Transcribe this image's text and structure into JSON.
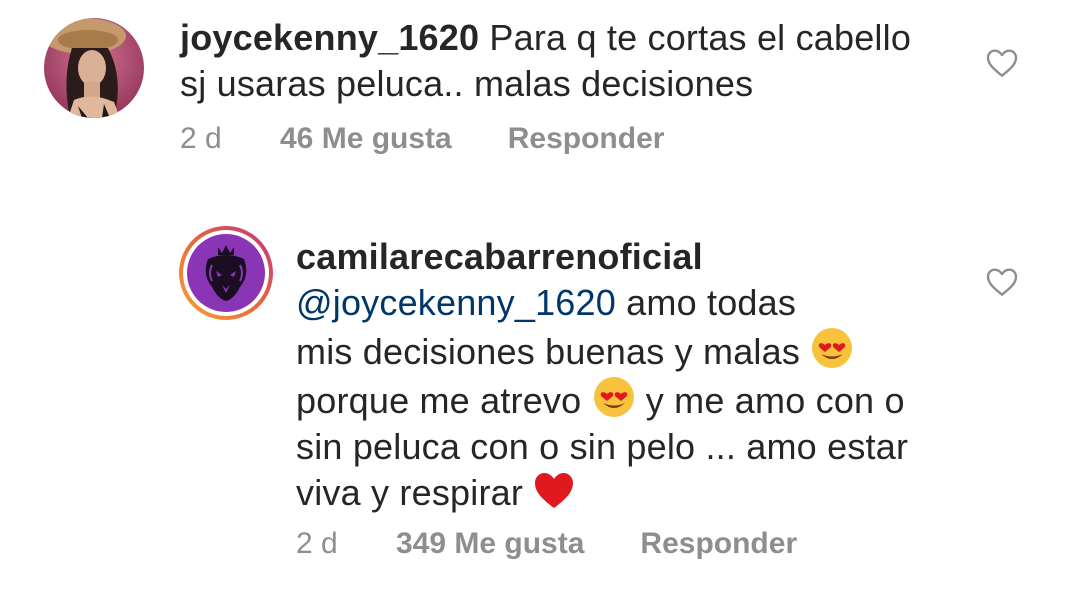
{
  "comment": {
    "username": "joycekenny_1620",
    "text_line1": "Para q te cortas el cabello",
    "text_line2": "sj usaras peluca.. malas decisiones",
    "time": "2 d",
    "likes": "46 Me gusta",
    "reply_label": "Responder"
  },
  "reply": {
    "username": "camilarecabarrenoficial",
    "mention": "@joycekenny_1620",
    "line1_rest": " amo todas",
    "line2": "mis decisiones buenas y malas ",
    "line3a": "porque me atrevo ",
    "line3b": " y me amo con o",
    "line4": "sin peluca con o sin pelo ... amo estar",
    "line5": "viva y respirar ",
    "time": "2 d",
    "likes": "349 Me gusta",
    "reply_label": "Responder"
  },
  "icons": {
    "like": "heart-outline-icon",
    "heart_eyes": "heart-eyes-emoji",
    "red_heart": "red-heart-emoji"
  },
  "colors": {
    "text": "#262626",
    "meta": "#8e8e8e",
    "mention": "#00376b",
    "heart": "#e0191f"
  }
}
